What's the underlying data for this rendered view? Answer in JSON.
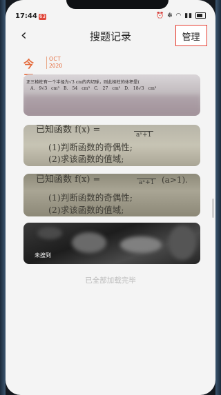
{
  "status_bar": {
    "time": "17:44",
    "badge": "63",
    "icons": "⏰ ✻ ◠ ▮▮",
    "battery_icon": "battery-icon"
  },
  "header": {
    "back_icon": "chevron-left-icon",
    "title": "搜题记录",
    "manage_label": "管理",
    "highlight_color": "#e63b2e"
  },
  "section": {
    "today": "今天",
    "month": "OCT",
    "year": "2020"
  },
  "records": [
    {
      "line1": "正三棱柱有一个半径为√3 cm的内切球，则此棱柱的体积是(",
      "line2": "A. 9√3 cm³    B. 54 cm³    C. 27 cm³    D. 18√3 cm³"
    },
    {
      "line1": "已知函数 f(x) = ",
      "fraction": "aˣ+1",
      "line2": "(1)判断函数的奇偶性;",
      "line3": "(2)求该函数的值域;"
    },
    {
      "line1": "已知函数 f(x) = ",
      "fraction": "aˣ+1",
      "tail": "(a>1).",
      "line2": "(1)判断函数的奇偶性;",
      "line3": "(2)求该函数的值域;"
    },
    {
      "status": "未搜到"
    }
  ],
  "footer": "已全部加载完毕",
  "accent_color": "#e46a3b"
}
